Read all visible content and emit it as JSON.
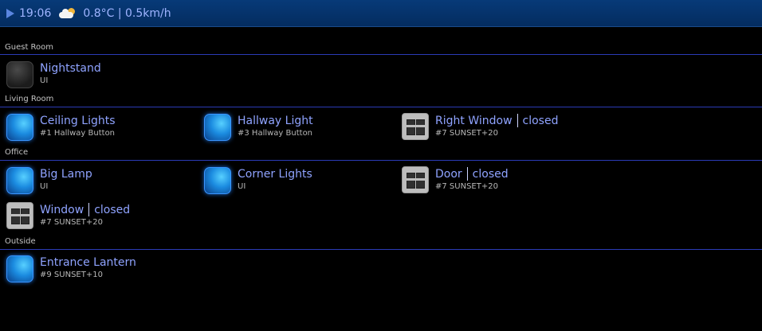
{
  "header": {
    "time": "19:06",
    "weather": "0.8°C | 0.5km/h"
  },
  "sections": [
    {
      "label": "Guest Room",
      "devices": [
        {
          "name": "Nightstand",
          "sub": "UI",
          "icon": "off"
        }
      ]
    },
    {
      "label": "Living Room",
      "devices": [
        {
          "name": "Ceiling Lights",
          "sub": "#1 Hallway Button",
          "icon": "on"
        },
        {
          "name": "Hallway Light",
          "sub": "#3 Hallway Button",
          "icon": "on"
        },
        {
          "name": "Right Window",
          "state": "closed",
          "sub": "#7 SUNSET+20",
          "icon": "shutter"
        }
      ]
    },
    {
      "label": "Office",
      "devices": [
        {
          "name": "Big Lamp",
          "sub": "UI",
          "icon": "on"
        },
        {
          "name": "Corner Lights",
          "sub": "UI",
          "icon": "on"
        },
        {
          "name": "Door",
          "state": "closed",
          "sub": "#7 SUNSET+20",
          "icon": "shutter"
        },
        {
          "name": "Window",
          "state": "closed",
          "sub": "#7 SUNSET+20",
          "icon": "shutter"
        }
      ]
    },
    {
      "label": "Outside",
      "devices": [
        {
          "name": "Entrance Lantern",
          "sub": "#9 SUNSET+10",
          "icon": "on"
        }
      ]
    }
  ]
}
